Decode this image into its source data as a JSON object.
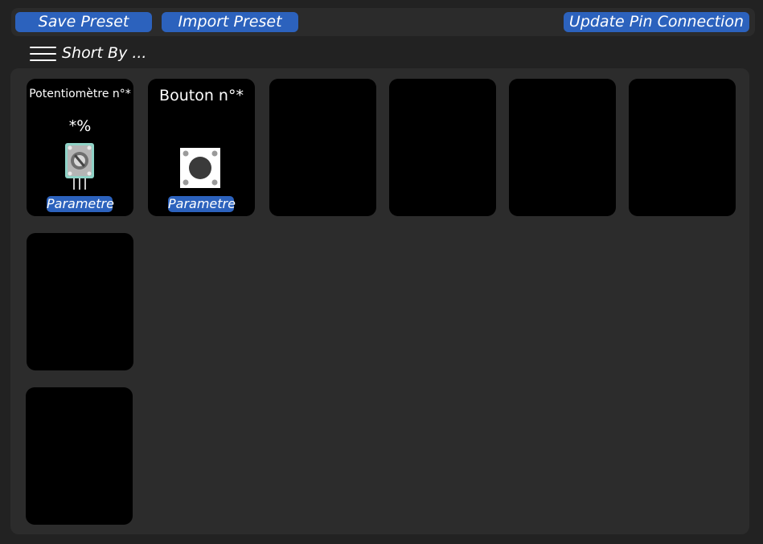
{
  "toolbar": {
    "save_label": "Save Preset",
    "import_label": "Import Preset",
    "update_label": "Update Pin Connection"
  },
  "sort": {
    "label": "Short By ..."
  },
  "cards": [
    {
      "title": "Potentiomètre n°*",
      "value": "*%",
      "param_label": "Parametre",
      "icon": "potentiometer-icon"
    },
    {
      "title": "Bouton n°*",
      "param_label": "Parametre",
      "icon": "push-button-icon"
    }
  ],
  "colors": {
    "background": "#222222",
    "panel": "#2c2c2c",
    "card": "#000000",
    "accent": "#2c62bd",
    "text": "#ffffff"
  }
}
